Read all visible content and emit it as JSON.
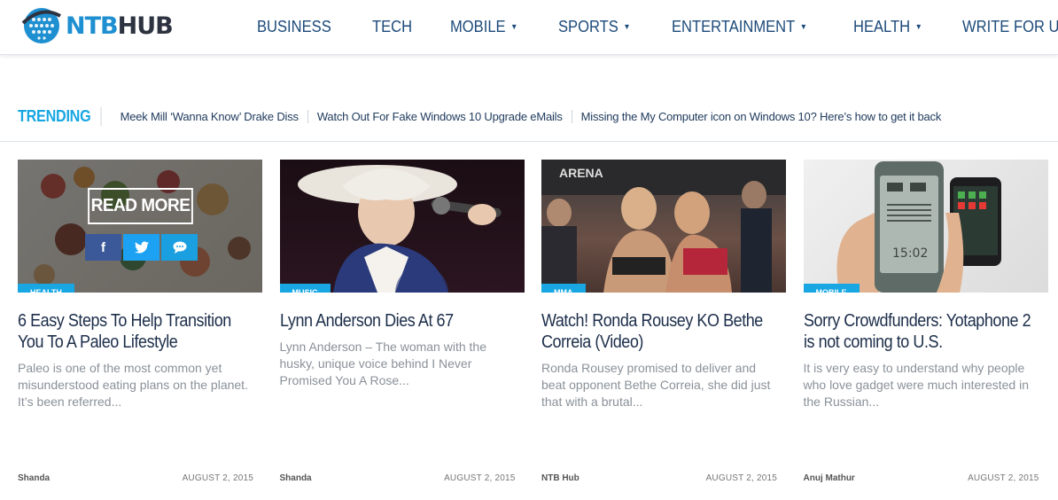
{
  "site": {
    "logo_ntb": "NTB",
    "logo_hub": "HUB"
  },
  "nav": [
    {
      "label": "BUSINESS",
      "dropdown": false
    },
    {
      "label": "TECH",
      "dropdown": false
    },
    {
      "label": "MOBILE",
      "dropdown": true
    },
    {
      "label": "SPORTS",
      "dropdown": true
    },
    {
      "label": "ENTERTAINMENT",
      "dropdown": true
    },
    {
      "label": "HEALTH",
      "dropdown": true
    },
    {
      "label": "WRITE FOR US",
      "dropdown": false
    }
  ],
  "trending": {
    "label": "TRENDING",
    "links": [
      "Meek Mill ‘Wanna Know’ Drake Diss",
      "Watch Out For Fake Windows 10 Upgrade eMails",
      "Missing the My Computer icon on Windows 10? Here’s how to get it back"
    ]
  },
  "hover_overlay": {
    "read_more": "READ MORE",
    "share_icons": [
      "facebook-icon",
      "twitter-icon",
      "comment-icon"
    ]
  },
  "colors": {
    "accent": "#18a7e3",
    "nav_text": "#1c4a7a",
    "title_text": "#1c2e4a",
    "excerpt_text": "#8a9199"
  },
  "cards": [
    {
      "category": "HEALTH",
      "title": "6 Easy Steps To Help Transition You To A Paleo Lifestyle",
      "excerpt": "Paleo is one of the most common yet misunderstood eating plans on the planet. It’s been referred...",
      "author": "Shanda",
      "date": "AUGUST 2, 2015"
    },
    {
      "category": "MUSIC",
      "title": "Lynn Anderson Dies At 67",
      "excerpt": "Lynn Anderson – The woman with the husky, unique voice behind I Never Promised You A Rose...",
      "author": "Shanda",
      "date": "AUGUST 2, 2015"
    },
    {
      "category": "MMA",
      "title": "Watch! Ronda Rousey KO Bethe Correia (Video)",
      "excerpt": "Ronda Rousey promised to deliver and beat opponent Bethe Correia, she did just that with a brutal...",
      "author": "NTB Hub",
      "date": "AUGUST 2, 2015"
    },
    {
      "category": "MOBILE",
      "title": "Sorry Crowdfunders: Yotaphone 2 is not coming to U.S.",
      "excerpt": "It is very easy to understand why people who love gadget were much interested in the Russian...",
      "author": "Anuj Mathur",
      "date": "AUGUST 2, 2015"
    }
  ]
}
